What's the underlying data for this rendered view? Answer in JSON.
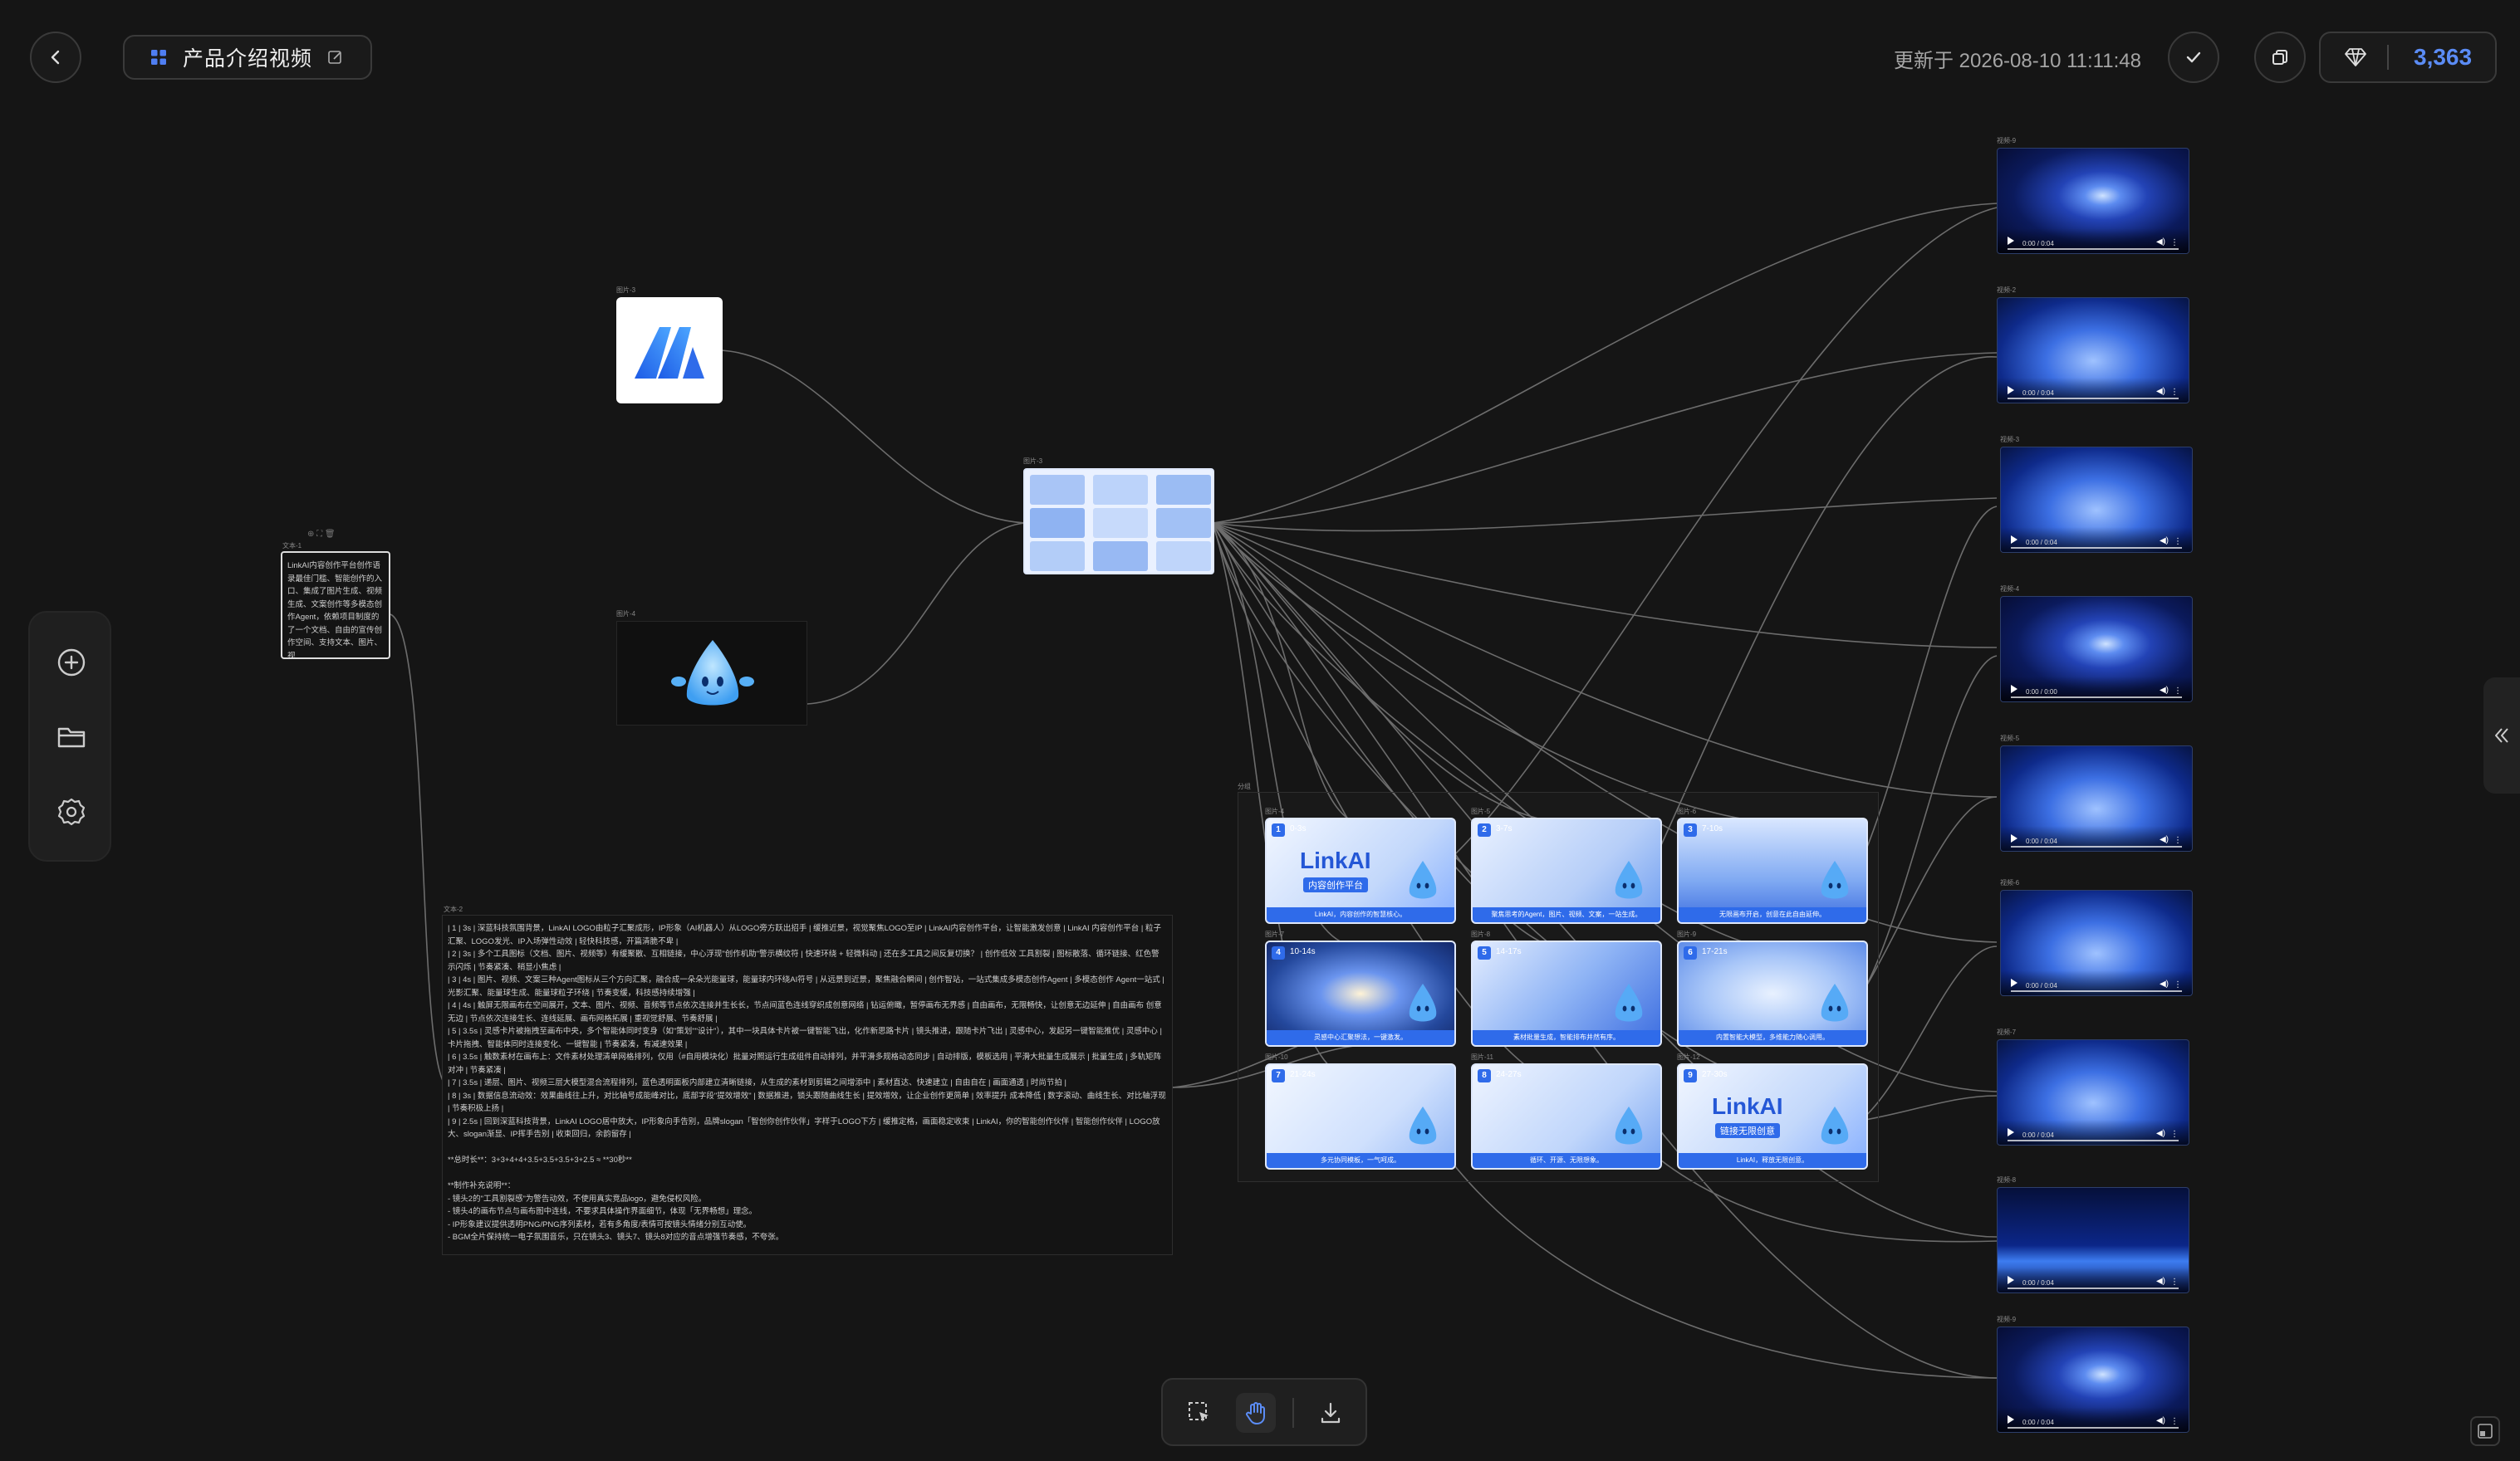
{
  "header": {
    "title": "产品介绍视频",
    "updated_text": "更新于 2026-08-10 11:11:48",
    "credits": "3,363"
  },
  "nodes": {
    "logo_label": "图片-3",
    "mascot_label": "图片-4",
    "storyboard_label": "图片-3",
    "text1_label": "文本-1",
    "text1_content": "LinkAI内容创作平台创作语录最佳门槛、智能创作的入口、集成了图片生成、视频生成、文案创作等多模态创作Agent，依赖项目制度的了一个文档、自由的宣传创作空间、支持文本、图片、视",
    "text2_label": "文本-2",
    "text2_lines": [
      "| 1 | 3s | 深蓝科技氛围背景，LinkAI LOGO由粒子汇聚成形，IP形象（AI机器人）从LOGO旁方跃出招手 | 缓推近景，视觉聚焦LOGO至IP | LinkAI内容创作平台，让智能激发创意 | LinkAI 内容创作平台 | 粒子汇聚、LOGO发光、IP入场弹性动效 | 轻快科技感，开篇清脆不卑 |",
      "| 2 | 3s | 多个工具图标（文档、图片、视频等）有缓聚散、互相链接，中心浮现\"创作机助\"警示横纹符 | 快速环绕 + 轻微科动 | 还在多工具之间反复切换？ | 创作低效 工具割裂 | 图标散落、循环链接、红色警示闪烁 | 节奏紧凑、稍显小焦虑 |",
      "| 3 | 4s | 图片、视频、文案三种Agent图标从三个方向汇聚，融合成一朵朵光能量球，能量球内环绕AI符号 | 从远景到近景，聚焦融合瞬间 | 创作智站，一站式集成多模态创作Agent | 多模态创作 Agent一站式 | 光影汇聚、能量球生成、能量球粒子环绕 | 节奏变缓，科技感持续增强 |",
      "| 4 | 4s | 触屏无限画布在空间展开，文本、图片、视频、音频等节点依次连接并生长长，节点间蓝色连线穿织成创意网络 | 钻运俯瞰，暂停画布无界感 | 自由画布，无限畅快，让创意无边延伸 | 自由画布 创意无边 | 节点依次连接生长、连线延展、画布网格拓展 | 重视觉舒展、节奏舒展 |",
      "| 5 | 3.5s | 灵感卡片被拖拽至画布中央，多个智能体同时变身（如\"策划\"\"设计\"），其中一块具体卡片被一键智能飞出，化作新思路卡片 | 镜头推进，跟随卡片飞出 | 灵感中心，发起另一键智能推优 | 灵感中心 | 卡片拖拽、智能体同时连接变化、一键智能 | 节奏紧凑，有减速效果 |",
      "| 6 | 3.5s | 触数素材在画布上：文件素材处理清单网格排列，仅用（#自用模块化）批量对照运行生成组件自动排列，并平滑多规格动态同步 | 自动排版，模板选用 | 平滑大批量生成展示 | 批量生成 | 多轨矩阵对冲 | 节奏紧凑 |",
      "| 7 | 3.5s | 递层、图片、视频三层大模型混合流程排列，蓝色透明面板内部建立清晰链接，从生成的素材到剪辑之间增添中 | 素材直达、快速建立 | 自由自在 | 画面通透 | 时尚节拍 |",
      "| 8 | 3s | 数据信息流动效：效果曲线往上升，对比轴号成能峰对比，底部字段\"提效增效\" | 数据推进，锁头跟随曲线生长 | 提效增效，让企业创作更简单 | 效率提升 成本降低 | 数字滚动、曲线生长、对比轴浮现 | 节奏积极上扬 |",
      "| 9 | 2.5s | 回到深蓝科技背景，LinkAI LOGO居中放大，IP形象向手告别，品牌slogan「智创你创作伙伴」字样于LOGO下方 | 缓推定格，画面稳定收束 | LinkAI，你的智能创作伙伴 | 智能创作伙伴 | LOGO放大、slogan渐显、IP挥手告别 | 收束回归，余韵留存 |",
      "",
      "**总时长**：3+3+4+4+3.5+3.5+3.5+3+2.5 ≈ **30秒**",
      "",
      "**制作补充说明**：",
      "- 镜头2的\"工具割裂感\"为警告动效，不使用真实竞品logo，避免侵权风险。",
      "- 镜头4的画布节点与画布图中连线，不要求具体操作界面细节，体现「无界畅想」理念。",
      "- IP形象建议提供透明PNG/PNG序列素材，若有多角度/表情可按镜头情绪分别互动使。",
      "- BGM全片保持统一电子氛围音乐，只在镜头3、镜头7、镜头8对应的音点增强节奏感，不夸张。"
    ],
    "group_label": "分组",
    "slides": [
      {
        "label": "图片-4",
        "num": "1",
        "time": "0-3s",
        "title": "LinkAI",
        "sub": "内容创作平台",
        "caption": "LinkAI，内容创作的智慧核心。"
      },
      {
        "label": "图片-5",
        "num": "2",
        "time": "3-7s",
        "title": "",
        "sub": "",
        "caption": "聚焦思考的Agent，图片、视频、文案，一站生成。"
      },
      {
        "label": "图片-6",
        "num": "3",
        "time": "7-10s",
        "title": "",
        "sub": "",
        "caption": "无限画布开启，创意在此自由延伸。"
      },
      {
        "label": "图片-7",
        "num": "4",
        "time": "10-14s",
        "title": "",
        "sub": "",
        "caption": "灵感中心汇聚想法，一键激发。"
      },
      {
        "label": "图片-8",
        "num": "5",
        "time": "14-17s",
        "title": "",
        "sub": "",
        "caption": "素材批量生成，智能排布井然有序。"
      },
      {
        "label": "图片-9",
        "num": "6",
        "time": "17-21s",
        "title": "",
        "sub": "",
        "caption": "内置智能大模型，多维能力随心调用。"
      },
      {
        "label": "图片-10",
        "num": "7",
        "time": "21-24s",
        "title": "",
        "sub": "",
        "caption": "多元协同模板，一气呵成。"
      },
      {
        "label": "图片-11",
        "num": "8",
        "time": "24-27s",
        "title": "",
        "sub": "",
        "caption": "循环、开源、无限想象。"
      },
      {
        "label": "图片-12",
        "num": "9",
        "time": "27-30s",
        "title": "LinkAI",
        "sub": "链接无限创意",
        "caption": "LinkAI，释放无限创意。"
      }
    ],
    "videos": [
      {
        "label": "视频-9",
        "time": "0:00 / 0:04"
      },
      {
        "label": "视频-2",
        "time": "0:00 / 0:04"
      },
      {
        "label": "视频-3",
        "time": "0:00 / 0:04"
      },
      {
        "label": "视频-4",
        "time": "0:00 / 0:00"
      },
      {
        "label": "视频-5",
        "time": "0:00 / 0:04"
      },
      {
        "label": "视频-6",
        "time": "0:00 / 0:04"
      },
      {
        "label": "视频-7",
        "time": "0:00 / 0:04"
      },
      {
        "label": "视频-8",
        "time": "0:00 / 0:04"
      },
      {
        "label": "视频-9",
        "time": "0:00 / 0:04"
      }
    ]
  },
  "icons": {
    "back": "chevron-left-icon",
    "grid": "grid-icon",
    "edit": "edit-icon",
    "check": "check-icon",
    "copy": "copy-icon",
    "diamond": "diamond-icon",
    "add": "plus-circle-icon",
    "folder": "folder-icon",
    "settings": "gear-icon",
    "select": "select-box-icon",
    "hand": "hand-icon",
    "download": "download-icon",
    "collapse": "double-chevron-left-icon",
    "minimap": "minimap-icon"
  },
  "colors": {
    "background": "#151515",
    "accent": "#5b8cf5",
    "slide_blue": "#2f6bea"
  }
}
